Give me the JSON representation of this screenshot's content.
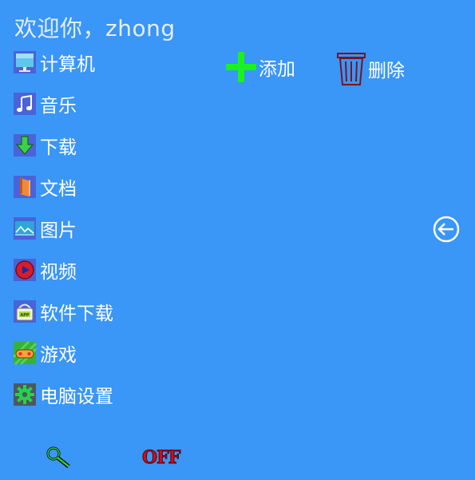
{
  "header": {
    "welcome": "欢迎你，zhong"
  },
  "sidebar": {
    "items": [
      {
        "label": "计算机",
        "icon": "computer-icon"
      },
      {
        "label": "音乐",
        "icon": "music-icon"
      },
      {
        "label": "下载",
        "icon": "download-icon"
      },
      {
        "label": "文档",
        "icon": "document-icon"
      },
      {
        "label": "图片",
        "icon": "picture-icon"
      },
      {
        "label": "视频",
        "icon": "video-icon"
      },
      {
        "label": "软件下载",
        "icon": "app-download-icon"
      },
      {
        "label": "游戏",
        "icon": "game-icon"
      },
      {
        "label": "电脑设置",
        "icon": "settings-icon"
      }
    ]
  },
  "toolbar": {
    "add_label": "添加",
    "delete_label": "删除"
  },
  "footer": {
    "off_label": "OFF"
  },
  "colors": {
    "background": "#3a96f7",
    "add_accent": "#19f21b",
    "delete_accent": "#7a1420",
    "off_accent": "#c8111b"
  }
}
